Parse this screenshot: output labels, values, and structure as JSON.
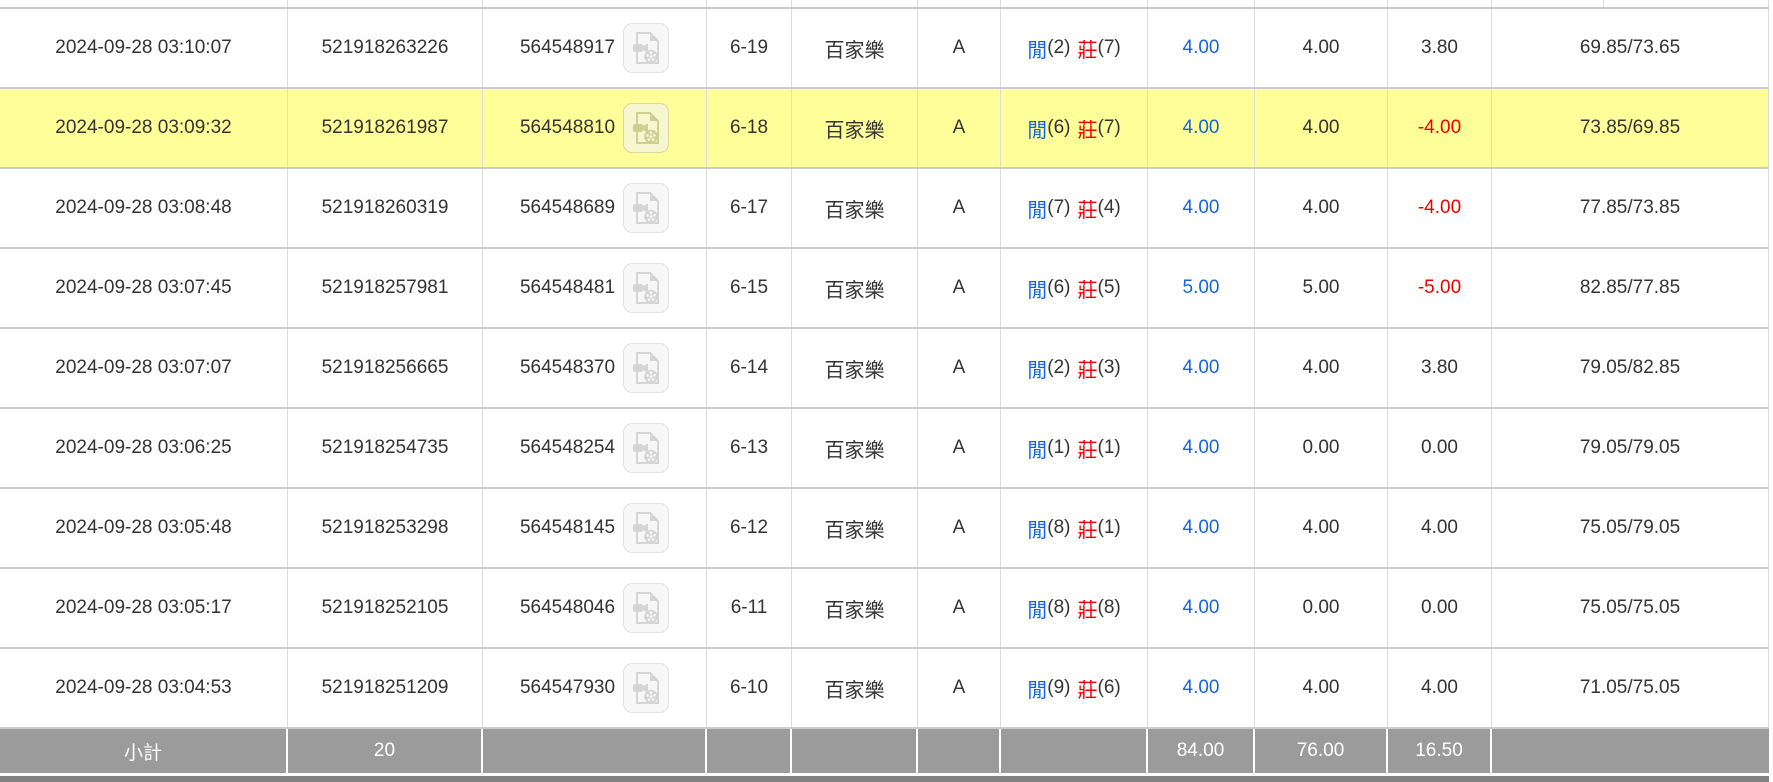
{
  "labels": {
    "player": "閒",
    "banker": "莊"
  },
  "icons": {
    "video_button": "video-record-icon"
  },
  "colors": {
    "highlight_yellow": "#FFFF99",
    "bet_blue": "#1266E3",
    "loss_red": "#EE0000",
    "subtotal_gray": "#9B9B9B",
    "next_row_gray": "#828282",
    "row_divider": "#CBCBCB"
  },
  "rows": [
    {
      "time": "2024-09-28 03:10:07",
      "bet_id": "521918263226",
      "round_id": "564548917",
      "shoe_round": "6-19",
      "game": "百家樂",
      "table": "A",
      "player": "2",
      "banker": "7",
      "bet": "4.00",
      "valid": "4.00",
      "win_loss": "3.80",
      "balance": "69.85/73.65",
      "highlighted": false
    },
    {
      "time": "2024-09-28 03:09:32",
      "bet_id": "521918261987",
      "round_id": "564548810",
      "shoe_round": "6-18",
      "game": "百家樂",
      "table": "A",
      "player": "6",
      "banker": "7",
      "bet": "4.00",
      "valid": "4.00",
      "win_loss": "-4.00",
      "balance": "73.85/69.85",
      "highlighted": true
    },
    {
      "time": "2024-09-28 03:08:48",
      "bet_id": "521918260319",
      "round_id": "564548689",
      "shoe_round": "6-17",
      "game": "百家樂",
      "table": "A",
      "player": "7",
      "banker": "4",
      "bet": "4.00",
      "valid": "4.00",
      "win_loss": "-4.00",
      "balance": "77.85/73.85",
      "highlighted": false
    },
    {
      "time": "2024-09-28 03:07:45",
      "bet_id": "521918257981",
      "round_id": "564548481",
      "shoe_round": "6-15",
      "game": "百家樂",
      "table": "A",
      "player": "6",
      "banker": "5",
      "bet": "5.00",
      "valid": "5.00",
      "win_loss": "-5.00",
      "balance": "82.85/77.85",
      "highlighted": false
    },
    {
      "time": "2024-09-28 03:07:07",
      "bet_id": "521918256665",
      "round_id": "564548370",
      "shoe_round": "6-14",
      "game": "百家樂",
      "table": "A",
      "player": "2",
      "banker": "3",
      "bet": "4.00",
      "valid": "4.00",
      "win_loss": "3.80",
      "balance": "79.05/82.85",
      "highlighted": false
    },
    {
      "time": "2024-09-28 03:06:25",
      "bet_id": "521918254735",
      "round_id": "564548254",
      "shoe_round": "6-13",
      "game": "百家樂",
      "table": "A",
      "player": "1",
      "banker": "1",
      "bet": "4.00",
      "valid": "0.00",
      "win_loss": "0.00",
      "balance": "79.05/79.05",
      "highlighted": false
    },
    {
      "time": "2024-09-28 03:05:48",
      "bet_id": "521918253298",
      "round_id": "564548145",
      "shoe_round": "6-12",
      "game": "百家樂",
      "table": "A",
      "player": "8",
      "banker": "1",
      "bet": "4.00",
      "valid": "4.00",
      "win_loss": "4.00",
      "balance": "75.05/79.05",
      "highlighted": false
    },
    {
      "time": "2024-09-28 03:05:17",
      "bet_id": "521918252105",
      "round_id": "564548046",
      "shoe_round": "6-11",
      "game": "百家樂",
      "table": "A",
      "player": "8",
      "banker": "8",
      "bet": "4.00",
      "valid": "0.00",
      "win_loss": "0.00",
      "balance": "75.05/75.05",
      "highlighted": false
    },
    {
      "time": "2024-09-28 03:04:53",
      "bet_id": "521918251209",
      "round_id": "564547930",
      "shoe_round": "6-10",
      "game": "百家樂",
      "table": "A",
      "player": "9",
      "banker": "6",
      "bet": "4.00",
      "valid": "4.00",
      "win_loss": "4.00",
      "balance": "71.05/75.05",
      "highlighted": false
    }
  ],
  "subtotal": {
    "label": "小計",
    "count": "20",
    "bet_total": "84.00",
    "valid_total": "76.00",
    "win_loss_total": "16.50"
  }
}
